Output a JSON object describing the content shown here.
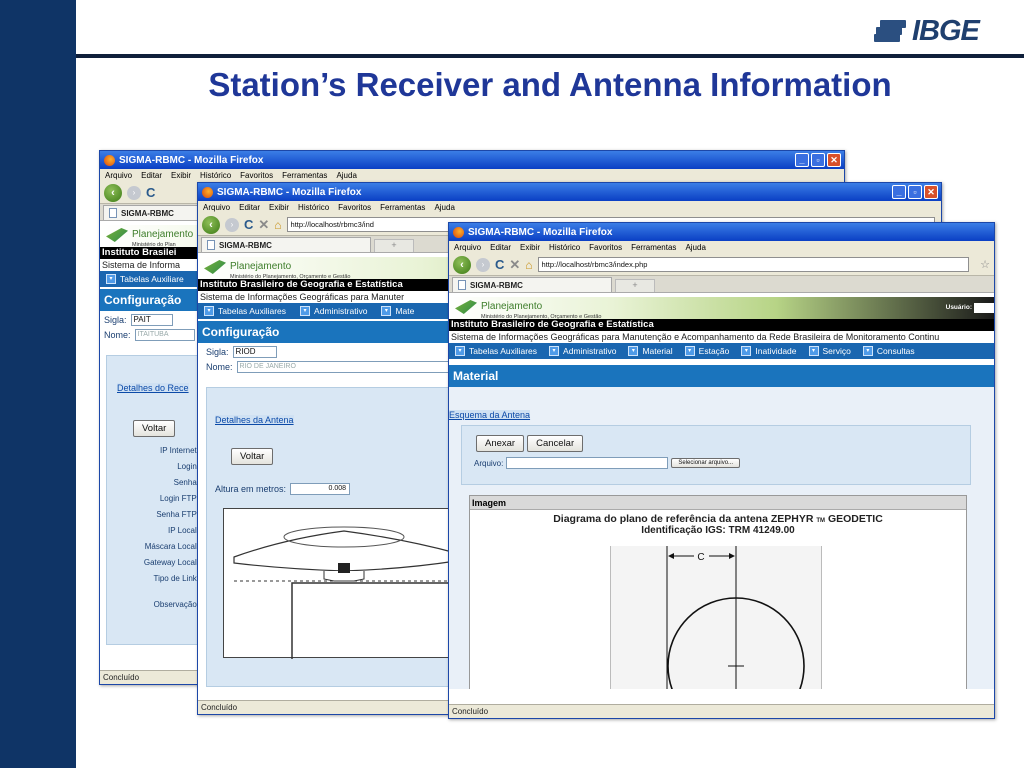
{
  "slide": {
    "title": "Station’s Receiver and Antenna Information",
    "logo_text": "IBGE",
    "colors": {
      "left_bar": "#0f3466",
      "title": "#1f3798",
      "window_border": "#1c47a8"
    }
  },
  "browser": {
    "window_title": "SIGMA-RBMC - Mozilla Firefox",
    "menu": [
      "Arquivo",
      "Editar",
      "Exibir",
      "Histórico",
      "Favoritos",
      "Ferramentas",
      "Ajuda"
    ],
    "tab_label": "SIGMA-RBMC",
    "url": "http://localhost/rbmc3/index.php",
    "url_short": "http://localhost/rbmc3/ind",
    "status": "Concluído"
  },
  "app": {
    "banner_title": "Planejamento",
    "banner_subtitle": "Ministério do Planejamento, Orçamento e Gestão",
    "banner_subtitle_short": "Ministério do Plan",
    "institute": "Instituto Brasileiro de Geografia e Estatística",
    "institute_short": "Instituto Brasilei",
    "system_full": "Sistema de Informações Geográficas para Manutenção e Acompanhamento da Rede Brasileira de Monitoramento Continu",
    "system_mid": "Sistema de Informações Geográficas para Manuter",
    "system_short": "Sistema de Informa",
    "user_label": "Usuário:",
    "menu_full": [
      "Tabelas Auxiliares",
      "Administrativo",
      "Material",
      "Estação",
      "Inatividade",
      "Serviço",
      "Consultas"
    ],
    "menu_mid": [
      "Tabelas Auxiliares",
      "Administrativo",
      "Mate"
    ],
    "menu_short": [
      "Tabelas Auxiliare"
    ]
  },
  "win1": {
    "section": "Configuração",
    "sigla_label": "Sigla:",
    "sigla_value": "PAIT",
    "nome_label": "Nome:",
    "nome_value": "ITAITUBA",
    "details_link": "Detalhes do Rece",
    "back_button": "Voltar",
    "fields": [
      "IP Internet:",
      "Login:",
      "Senha:",
      "Login FTP:",
      "Senha FTP:",
      "IP Local:",
      "Máscara Local:",
      "Gateway Local:",
      "Tipo de Link:"
    ],
    "obs_label": "Observação:"
  },
  "win2": {
    "section": "Configuração",
    "sigla_label": "Sigla:",
    "sigla_value": "RIOD",
    "nome_label": "Nome:",
    "nome_value": "RIO DE JANEIRO",
    "details_link": "Detalhes da Antena",
    "back_button": "Voltar",
    "height_label": "Altura em metros:",
    "height_value": "0.008"
  },
  "win3": {
    "section": "Material",
    "schema_link": "Esquema da Antena",
    "attach_button": "Anexar",
    "cancel_button": "Cancelar",
    "file_label": "Arquivo:",
    "browse_button": "Selecionar arquivo...",
    "image_header": "Imagem",
    "diagram_title_pre": "Diagrama do plano de referência da antena ZEPHYR",
    "diagram_tm": "TM",
    "diagram_title_post": "GEODETIC",
    "diagram_id": "Identificação IGS: TRM 41249.00",
    "dim_label": "C"
  }
}
